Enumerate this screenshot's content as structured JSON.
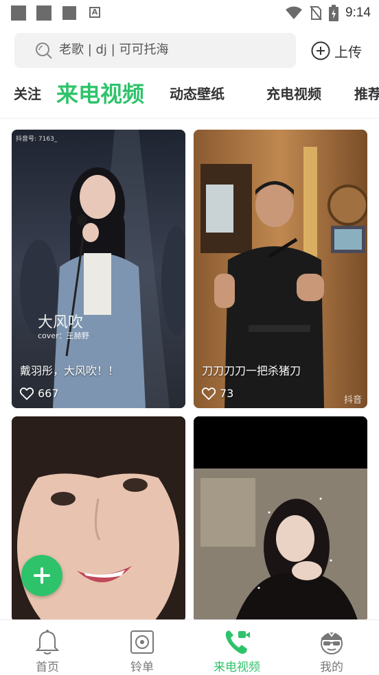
{
  "status_bar": {
    "time": "9:14"
  },
  "search": {
    "placeholder": "老歌 | dj | 可可托海",
    "upload_label": "上传"
  },
  "tabs": [
    {
      "label": "关注",
      "active": false
    },
    {
      "label": "来电视频",
      "active": true
    },
    {
      "label": "动态壁纸",
      "active": false
    },
    {
      "label": "充电视频",
      "active": false
    },
    {
      "label": "推荐",
      "active": false
    }
  ],
  "videos": [
    {
      "caption": "戴羽彤，大风吹！！",
      "likes": "667",
      "overlay_title": "大风吹",
      "overlay_sub": "cover：王赫野",
      "watermark": "抖音号: 7163_"
    },
    {
      "caption": "刀刀刀刀一把杀猪刀",
      "likes": "73",
      "watermark": "抖音"
    },
    {
      "caption": "",
      "likes": ""
    },
    {
      "caption": "",
      "likes": ""
    }
  ],
  "bottom_nav": [
    {
      "label": "首页",
      "icon": "bell-icon",
      "active": false
    },
    {
      "label": "铃单",
      "icon": "ringtone-list-icon",
      "active": false
    },
    {
      "label": "来电视频",
      "icon": "phone-video-icon",
      "active": true
    },
    {
      "label": "我的",
      "icon": "profile-avatar-icon",
      "active": false
    }
  ],
  "colors": {
    "accent": "#2ec36b",
    "search_bg": "#f2f2f2",
    "nav_inactive": "#777777"
  }
}
